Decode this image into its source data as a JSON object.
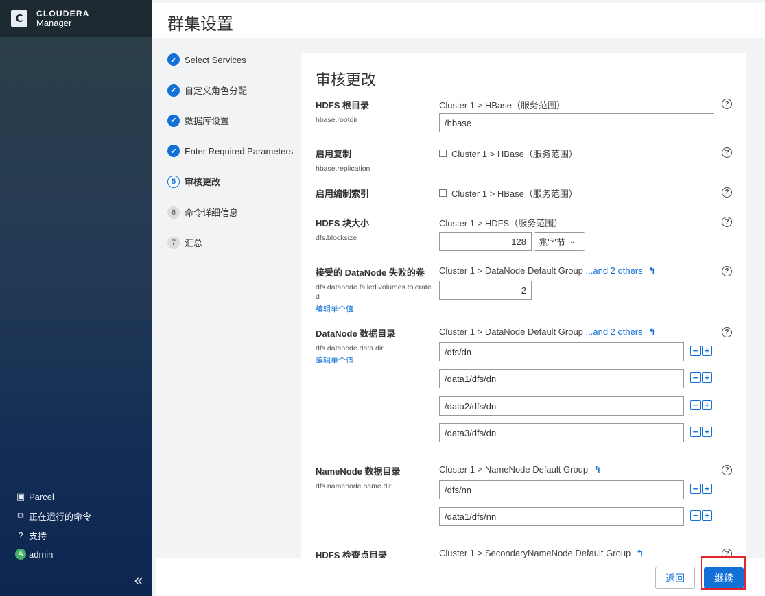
{
  "brand": {
    "name": "CLOUDERA",
    "product": "Manager"
  },
  "sidebar": {
    "items": [
      {
        "icon": "parcel-icon",
        "label": "Parcel"
      },
      {
        "icon": "running-commands-icon",
        "label": "正在运行的命令"
      },
      {
        "icon": "help-circle-icon",
        "label": "支持"
      }
    ],
    "user": {
      "avatar_letter": "A",
      "name": "admin"
    },
    "collapse_label": "«"
  },
  "header": {
    "title": "群集设置"
  },
  "steps": [
    {
      "num": "",
      "label": "Select Services",
      "state": "done"
    },
    {
      "num": "",
      "label": "自定义角色分配",
      "state": "done"
    },
    {
      "num": "",
      "label": "数据库设置",
      "state": "done"
    },
    {
      "num": "",
      "label": "Enter Required Parameters",
      "state": "done"
    },
    {
      "num": "5",
      "label": "审核更改",
      "state": "current"
    },
    {
      "num": "6",
      "label": "命令详细信息",
      "state": "todo"
    },
    {
      "num": "7",
      "label": "汇总",
      "state": "todo"
    }
  ],
  "panel": {
    "title": "审核更改",
    "help_glyph": "?",
    "edit_label": "编辑单个值",
    "undo_glyph": "↰",
    "minus_glyph": "−",
    "plus_glyph": "+",
    "params": [
      {
        "label": "HDFS 根目录",
        "key": "hbase.rootdir",
        "scope": "Cluster 1 > HBase（服务范围）",
        "value": "/hbase"
      },
      {
        "label": "启用复制",
        "key": "hbase.replication",
        "scope": "Cluster 1 > HBase（服务范围）"
      },
      {
        "label": "启用编制索引",
        "key": "",
        "scope": "Cluster 1 > HBase（服务范围）"
      },
      {
        "label": "HDFS 块大小",
        "key": "dfs.blocksize",
        "scope": "Cluster 1 > HDFS（服务范围）",
        "value": "128",
        "unit": "兆字节"
      },
      {
        "label": "接受的 DataNode 失败的卷",
        "key": "dfs.datanode.failed.volumes.tolerated",
        "scope": "Cluster 1 > DataNode Default Group ",
        "more": "...and 2 others",
        "value": "2"
      },
      {
        "label": "DataNode 数据目录",
        "key": "dfs.datanode.data.dir",
        "scope": "Cluster 1 > DataNode Default Group ",
        "more": "...and 2 others",
        "values": [
          "/dfs/dn",
          "/data1/dfs/dn",
          "/data2/dfs/dn",
          "/data3/dfs/dn"
        ]
      },
      {
        "label": "NameNode 数据目录",
        "key": "dfs.namenode.name.dir",
        "scope": "Cluster 1 > NameNode Default Group",
        "values": [
          "/dfs/nn",
          "/data1/dfs/nn"
        ]
      },
      {
        "label": "HDFS 检查点目录",
        "key": "",
        "scope": "Cluster 1 > SecondaryNameNode Default Group"
      }
    ]
  },
  "footer": {
    "back_label": "返回",
    "continue_label": "继续"
  },
  "colors": {
    "accent": "#1270d6",
    "highlight": "#e0262d"
  }
}
